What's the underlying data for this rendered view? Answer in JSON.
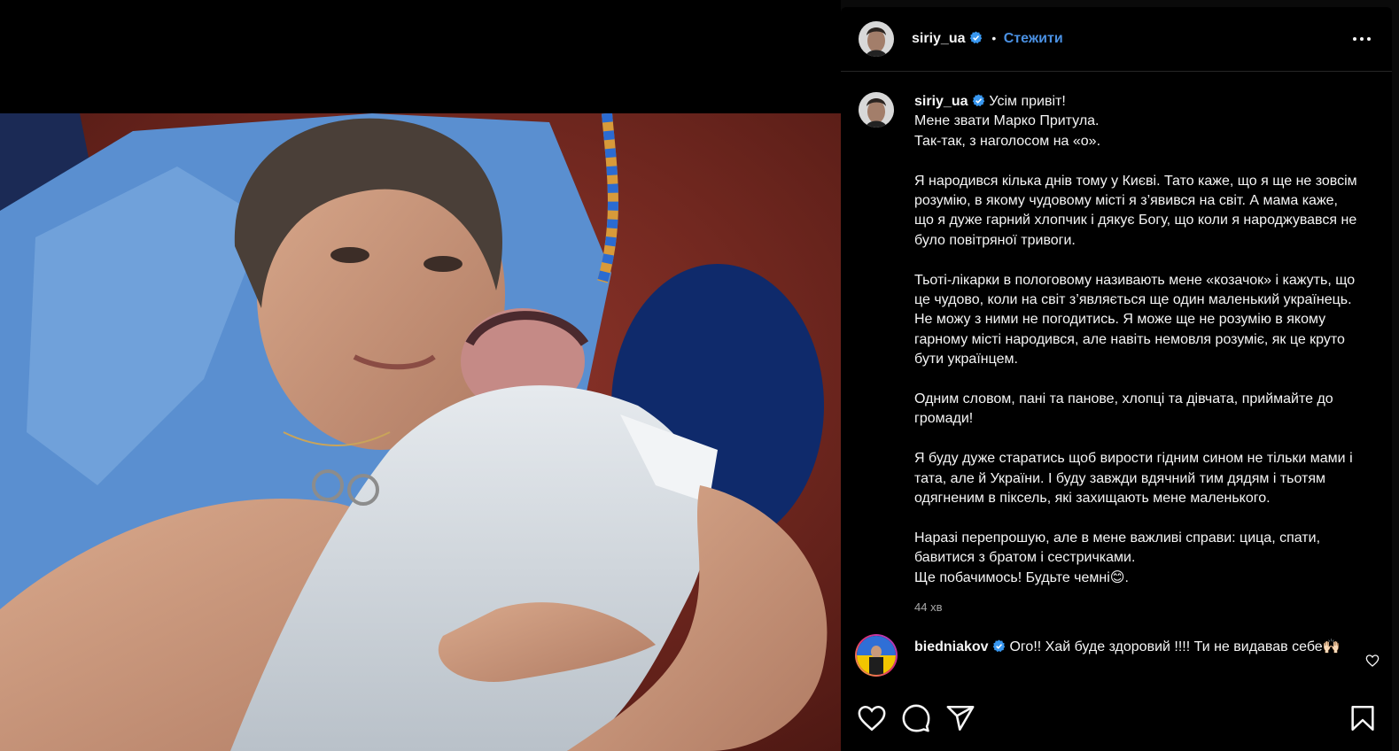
{
  "post": {
    "username": "siriy_ua",
    "follow_label": "Стежити",
    "separator": "•",
    "more_icon": "more-options-icon"
  },
  "caption": {
    "username": "siriy_ua",
    "lines": [
      "Усім привіт!",
      "Мене звати Марко Притула.",
      "Так-так, з наголосом на «о»."
    ],
    "p1": "Я народився кілька днів тому у Києві. Тато каже, що я ще не зовсім розумію, в якому чудовому місті я з’явився на світ. А мама каже, що я дуже гарний хлопчик і дякує Богу, що коли я народжувався не було повітряної тривоги.",
    "p2": "Тьоті-лікарки в пологовому називають мене «козачок» і кажуть, що це чудово, коли на світ з’являється ще один маленький українець. Не можу з ними не погодитись. Я може ще не розумію в якому гарному місті народився, але навіть немовля розуміє, як це круто бути українцем.",
    "p3": "Одним словом, пані та панове, хлопці та дівчата, приймайте до громади!",
    "p4": "Я буду дуже старатись щоб вирости гідним сином не тільки мами і тата, але й України. І буду завжди вдячний тим дядям і тьотям одягненим в піксель, які захищають мене маленького.",
    "p5a": "Наразі перепрошую, але в мене важливі справи: цица, спати, бавитися з братом і сестричками.",
    "p5b": "Ще побачимось! Будьте чемні😊.",
    "time": "44 хв"
  },
  "comment": {
    "username": "biedniakov",
    "text": "Ого!! Хай буде здоровий !!!! Ти не видавав себе🙌🏻"
  },
  "actions": {
    "like_icon": "heart-icon",
    "comment_icon": "comment-icon",
    "share_icon": "share-icon",
    "save_icon": "bookmark-icon"
  },
  "colors": {
    "panel_bg": "#000000",
    "link_blue": "#4a90e2",
    "verified_blue": "#3897f0",
    "muted_text": "#a8a8a8"
  }
}
